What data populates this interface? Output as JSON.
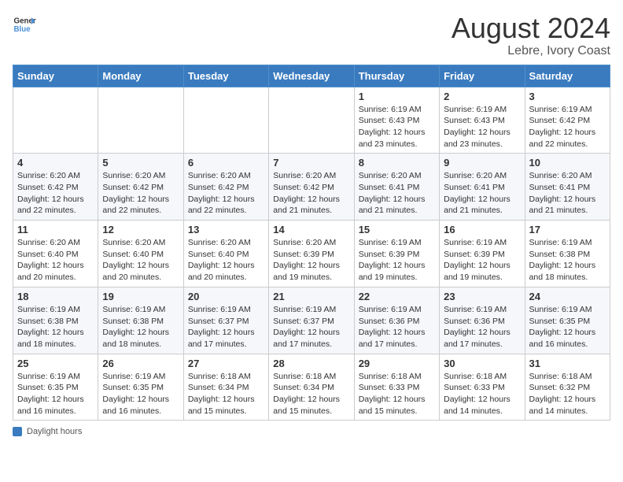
{
  "header": {
    "logo_general": "General",
    "logo_blue": "Blue",
    "title": "August 2024",
    "subtitle": "Lebre, Ivory Coast"
  },
  "calendar": {
    "days_of_week": [
      "Sunday",
      "Monday",
      "Tuesday",
      "Wednesday",
      "Thursday",
      "Friday",
      "Saturday"
    ],
    "weeks": [
      [
        {
          "day": "",
          "info": ""
        },
        {
          "day": "",
          "info": ""
        },
        {
          "day": "",
          "info": ""
        },
        {
          "day": "",
          "info": ""
        },
        {
          "day": "1",
          "info": "Sunrise: 6:19 AM\nSunset: 6:43 PM\nDaylight: 12 hours and 23 minutes."
        },
        {
          "day": "2",
          "info": "Sunrise: 6:19 AM\nSunset: 6:43 PM\nDaylight: 12 hours and 23 minutes."
        },
        {
          "day": "3",
          "info": "Sunrise: 6:19 AM\nSunset: 6:42 PM\nDaylight: 12 hours and 22 minutes."
        }
      ],
      [
        {
          "day": "4",
          "info": "Sunrise: 6:20 AM\nSunset: 6:42 PM\nDaylight: 12 hours and 22 minutes."
        },
        {
          "day": "5",
          "info": "Sunrise: 6:20 AM\nSunset: 6:42 PM\nDaylight: 12 hours and 22 minutes."
        },
        {
          "day": "6",
          "info": "Sunrise: 6:20 AM\nSunset: 6:42 PM\nDaylight: 12 hours and 22 minutes."
        },
        {
          "day": "7",
          "info": "Sunrise: 6:20 AM\nSunset: 6:42 PM\nDaylight: 12 hours and 21 minutes."
        },
        {
          "day": "8",
          "info": "Sunrise: 6:20 AM\nSunset: 6:41 PM\nDaylight: 12 hours and 21 minutes."
        },
        {
          "day": "9",
          "info": "Sunrise: 6:20 AM\nSunset: 6:41 PM\nDaylight: 12 hours and 21 minutes."
        },
        {
          "day": "10",
          "info": "Sunrise: 6:20 AM\nSunset: 6:41 PM\nDaylight: 12 hours and 21 minutes."
        }
      ],
      [
        {
          "day": "11",
          "info": "Sunrise: 6:20 AM\nSunset: 6:40 PM\nDaylight: 12 hours and 20 minutes."
        },
        {
          "day": "12",
          "info": "Sunrise: 6:20 AM\nSunset: 6:40 PM\nDaylight: 12 hours and 20 minutes."
        },
        {
          "day": "13",
          "info": "Sunrise: 6:20 AM\nSunset: 6:40 PM\nDaylight: 12 hours and 20 minutes."
        },
        {
          "day": "14",
          "info": "Sunrise: 6:20 AM\nSunset: 6:39 PM\nDaylight: 12 hours and 19 minutes."
        },
        {
          "day": "15",
          "info": "Sunrise: 6:19 AM\nSunset: 6:39 PM\nDaylight: 12 hours and 19 minutes."
        },
        {
          "day": "16",
          "info": "Sunrise: 6:19 AM\nSunset: 6:39 PM\nDaylight: 12 hours and 19 minutes."
        },
        {
          "day": "17",
          "info": "Sunrise: 6:19 AM\nSunset: 6:38 PM\nDaylight: 12 hours and 18 minutes."
        }
      ],
      [
        {
          "day": "18",
          "info": "Sunrise: 6:19 AM\nSunset: 6:38 PM\nDaylight: 12 hours and 18 minutes."
        },
        {
          "day": "19",
          "info": "Sunrise: 6:19 AM\nSunset: 6:38 PM\nDaylight: 12 hours and 18 minutes."
        },
        {
          "day": "20",
          "info": "Sunrise: 6:19 AM\nSunset: 6:37 PM\nDaylight: 12 hours and 17 minutes."
        },
        {
          "day": "21",
          "info": "Sunrise: 6:19 AM\nSunset: 6:37 PM\nDaylight: 12 hours and 17 minutes."
        },
        {
          "day": "22",
          "info": "Sunrise: 6:19 AM\nSunset: 6:36 PM\nDaylight: 12 hours and 17 minutes."
        },
        {
          "day": "23",
          "info": "Sunrise: 6:19 AM\nSunset: 6:36 PM\nDaylight: 12 hours and 17 minutes."
        },
        {
          "day": "24",
          "info": "Sunrise: 6:19 AM\nSunset: 6:35 PM\nDaylight: 12 hours and 16 minutes."
        }
      ],
      [
        {
          "day": "25",
          "info": "Sunrise: 6:19 AM\nSunset: 6:35 PM\nDaylight: 12 hours and 16 minutes."
        },
        {
          "day": "26",
          "info": "Sunrise: 6:19 AM\nSunset: 6:35 PM\nDaylight: 12 hours and 16 minutes."
        },
        {
          "day": "27",
          "info": "Sunrise: 6:18 AM\nSunset: 6:34 PM\nDaylight: 12 hours and 15 minutes."
        },
        {
          "day": "28",
          "info": "Sunrise: 6:18 AM\nSunset: 6:34 PM\nDaylight: 12 hours and 15 minutes."
        },
        {
          "day": "29",
          "info": "Sunrise: 6:18 AM\nSunset: 6:33 PM\nDaylight: 12 hours and 15 minutes."
        },
        {
          "day": "30",
          "info": "Sunrise: 6:18 AM\nSunset: 6:33 PM\nDaylight: 12 hours and 14 minutes."
        },
        {
          "day": "31",
          "info": "Sunrise: 6:18 AM\nSunset: 6:32 PM\nDaylight: 12 hours and 14 minutes."
        }
      ]
    ]
  },
  "footer": {
    "label": "Daylight hours"
  }
}
